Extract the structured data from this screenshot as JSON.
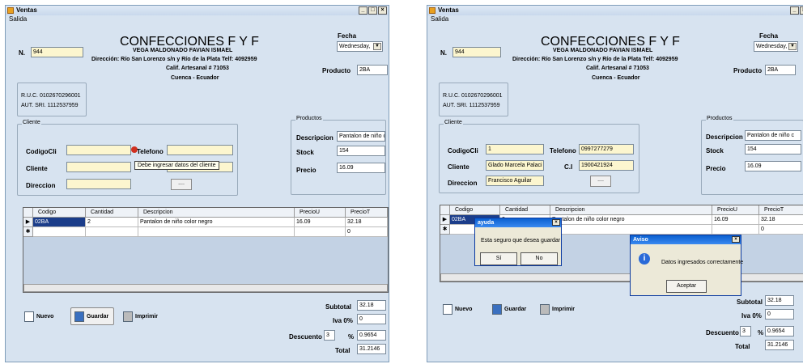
{
  "window_title": "Ventas",
  "menu": "Salida",
  "header": {
    "title": "CONFECCIONES F Y F",
    "owner": "VEGA MALDONADO FAVIAN ISMAEL",
    "address": "Dirección: Río San Lorenzo s/n y Río de la Plata  Telf: 4092959",
    "calif": "Calif. Artesanal # 71053",
    "city": "Cuenca - Ecuador"
  },
  "n_label": "N.",
  "n_value": "944",
  "fecha_label": "Fecha",
  "fecha_value": "Wednesday,",
  "producto_label": "Producto",
  "producto_value": "2BA",
  "ruc": "R.U.C. 0102670296001",
  "aut": "AUT. SRI. 1112537959",
  "cliente": {
    "group": "Cliente",
    "codigo_label": "CodigoCli",
    "telefono_label": "Telefono",
    "cliente_label": "Cliente",
    "ci_label": "C.I",
    "direccion_label": "Direccion",
    "button": "...."
  },
  "productos": {
    "group": "Productos",
    "descripcion_label": "Descripcion",
    "descripcion_value": "Pantalon de niño c",
    "stock_label": "Stock",
    "stock_value": "154",
    "precio_label": "Precio",
    "precio_value": "16.09"
  },
  "grid": {
    "headers": [
      "Codigo",
      "Cantidad",
      "Descripcion",
      "PrecioU",
      "PrecioT"
    ],
    "row": [
      "02BA",
      "2",
      "Pantalon de niño color negro",
      "16.09",
      "32.18"
    ],
    "new_row_total": "0",
    "row_marker": "▶",
    "new_marker": "✱"
  },
  "buttons": {
    "nuevo": "Nuevo",
    "guardar": "Guardar",
    "imprimir": "Imprimir"
  },
  "totals": {
    "subtotal_label": "Subtotal",
    "subtotal": "32.18",
    "iva_label": "Iva  0%",
    "iva": "0",
    "descuento_label": "Descuento",
    "descuento": "3",
    "pct": "%",
    "descuento_value": "0.9654",
    "total_label": "Total",
    "total": "31.2146"
  },
  "left": {
    "tooltip": "Debe ingresar datos del cliente"
  },
  "right": {
    "codigo": "1",
    "telefono": "0997277279",
    "cliente": "Glado Marcela   Palaci",
    "ci": "1900421924",
    "direccion": "Francisco Aguilar",
    "ayuda": {
      "title": "ayuda",
      "message": "Esta seguro que desea guardar",
      "yes": "Sí",
      "no": "No"
    },
    "aviso": {
      "title": "Aviso",
      "message": "Datos ingresados correctamente",
      "ok": "Aceptar"
    }
  },
  "colors": {
    "form_bg": "#d7e3f0",
    "field_bg": "#fcf6cf",
    "selection": "#1b3d8a"
  }
}
